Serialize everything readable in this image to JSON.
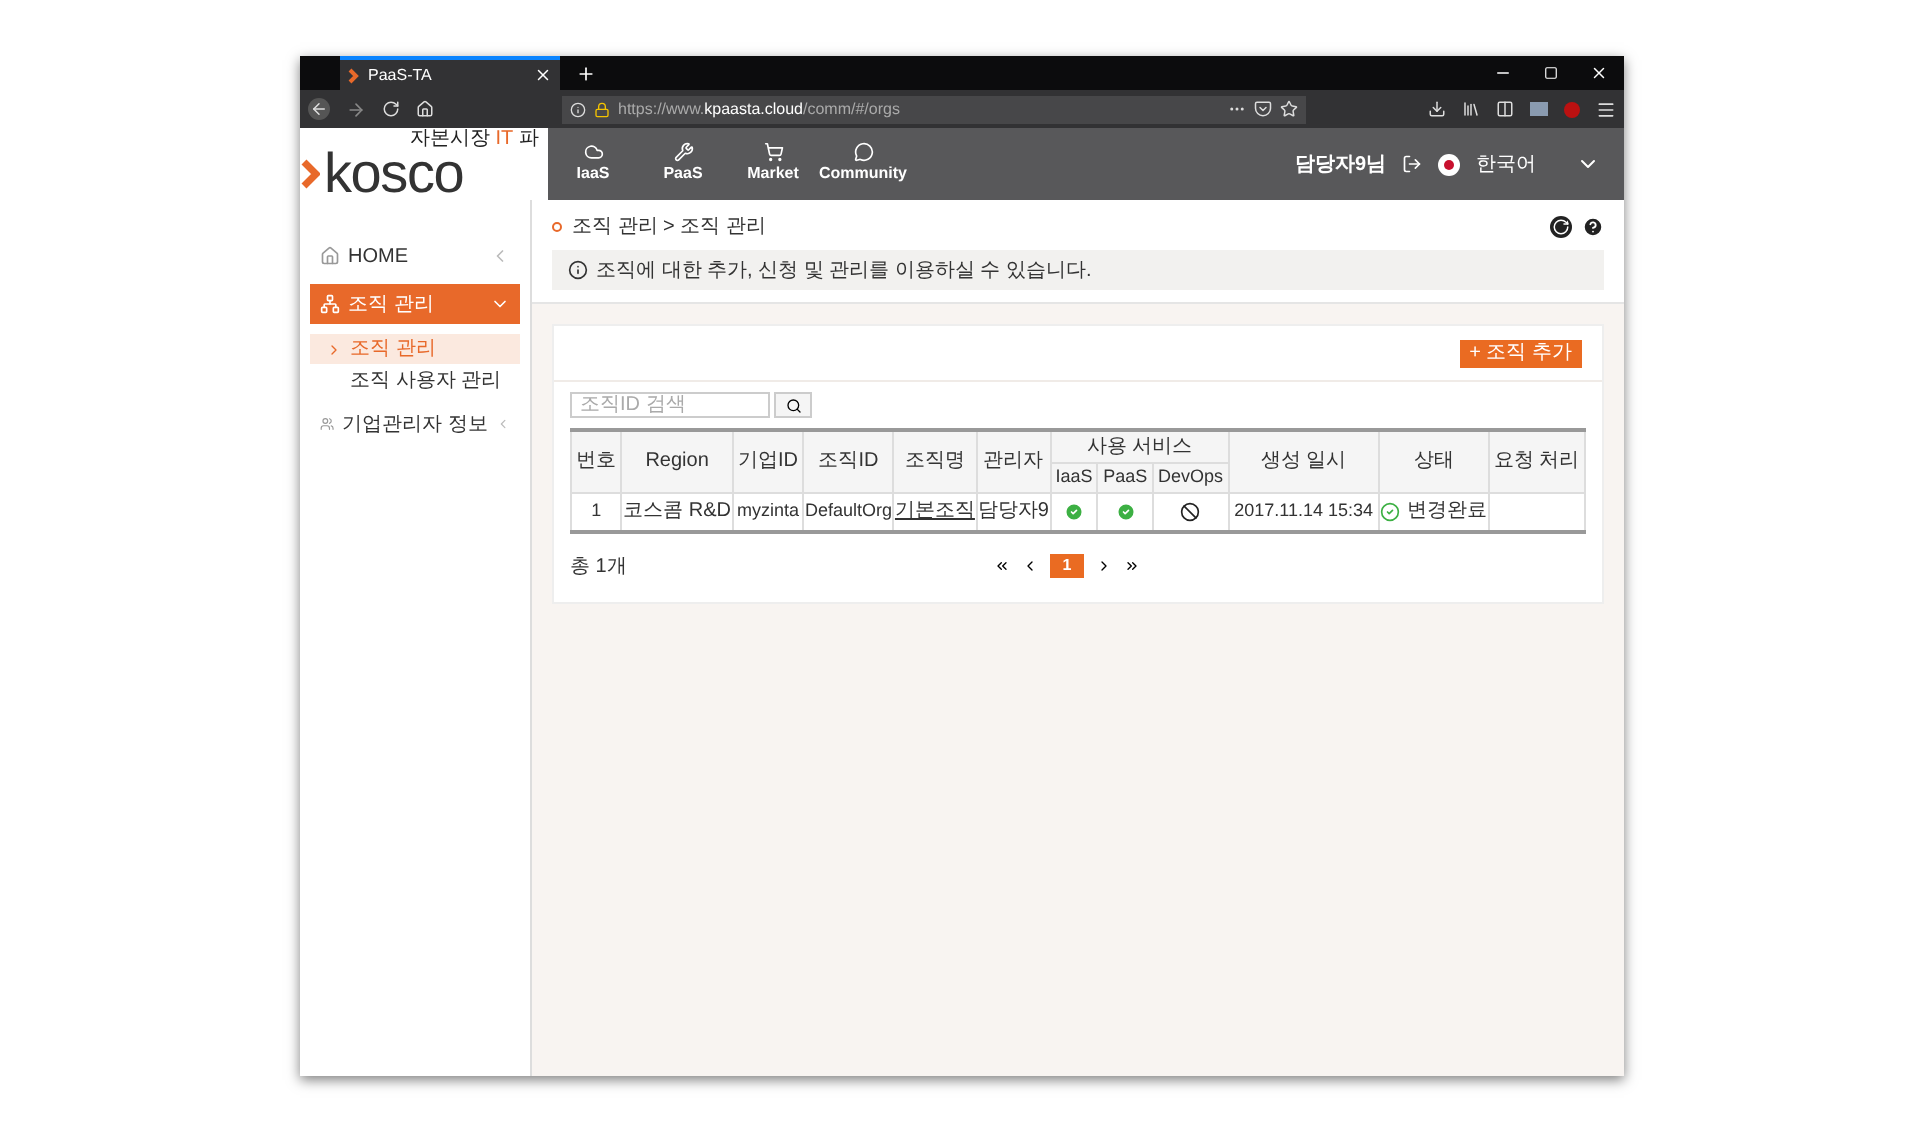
{
  "browser": {
    "tab_title": "PaaS-TA",
    "url_prefix": "https://www.",
    "url_host": "kpaasta.cloud",
    "url_path": "/comm/#/orgs"
  },
  "logo": {
    "tagline": [
      "자본시장",
      "IT",
      "파"
    ],
    "name": "kosco"
  },
  "nav": [
    {
      "label": "IaaS",
      "kind": "cloud"
    },
    {
      "label": "PaaS",
      "kind": "tools"
    },
    {
      "label": "Market",
      "kind": "cart"
    },
    {
      "label": "Community",
      "kind": "chat"
    }
  ],
  "header": {
    "user": "담당자9님",
    "language": "한국어"
  },
  "sidebar": {
    "items": [
      {
        "label": "HOME",
        "kind": "home",
        "expanded": false,
        "selected": false
      },
      {
        "label": "조직 관리",
        "kind": "org",
        "expanded": true,
        "selected": true,
        "children": [
          {
            "label": "조직 관리",
            "selected": true
          },
          {
            "label": "조직 사용자 관리",
            "selected": false
          }
        ]
      },
      {
        "label": "기업관리자 정보",
        "kind": "people",
        "expanded": false,
        "selected": false
      }
    ]
  },
  "breadcrumb": "조직 관리 > 조직 관리",
  "notice": "조직에 대한 추가, 신청 및 관리를 이용하실 수 있습니다.",
  "add_button": "+ 조직 추가",
  "search": {
    "placeholder": "조직ID 검색"
  },
  "table": {
    "columns": [
      "번호",
      "Region",
      "기업ID",
      "조직ID",
      "조직명",
      "관리자"
    ],
    "service_group": "사용 서비스",
    "services": [
      "IaaS",
      "PaaS",
      "DevOps"
    ],
    "columns_after": [
      "생성 일시",
      "상태",
      "요청 처리"
    ],
    "rows": [
      {
        "no": "1",
        "region": "코스콤 R&D",
        "company_id": "myzinta",
        "org_id": "DefaultOrg",
        "org_name": "기본조직",
        "manager": "담당자9",
        "services": [
          true,
          true,
          false
        ],
        "created": "2017.11.14 15:34",
        "status": "변경완료"
      }
    ]
  },
  "footer": {
    "total": "총 1개",
    "pages": [
      {
        "label": "1",
        "selected": true
      }
    ]
  }
}
